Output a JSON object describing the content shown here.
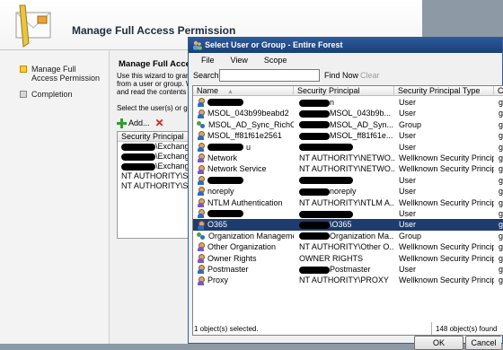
{
  "wizard": {
    "title": "Manage Full Access Permission",
    "nav": [
      {
        "label": "Manage Full Access Permission",
        "active": true
      },
      {
        "label": "Completion",
        "active": false
      }
    ],
    "content_title": "Manage Full Access",
    "desc_lines": [
      "Use this wizard to grant",
      "from a user or group. W",
      "and read the contents o"
    ],
    "select_text": "Select the user(s) or gro",
    "add_label": "Add...",
    "list_header": "Security Principal",
    "list_rows": [
      {
        "redacted": true,
        "text": "\\Exchange"
      },
      {
        "redacted": true,
        "text": "\\Exchange"
      },
      {
        "redacted": true,
        "text": "\\Exchange"
      },
      {
        "redacted": false,
        "text": "NT AUTHORITY\\SE"
      },
      {
        "redacted": false,
        "text": "NT AUTHORITY\\SY"
      }
    ]
  },
  "dialog": {
    "title": "Select User or Group - Entire Forest",
    "menu": [
      "File",
      "View",
      "Scope"
    ],
    "search_label": "Search:",
    "search_value": "",
    "find_now": "Find Now",
    "clear": "Clear",
    "columns": [
      "Name",
      "Security Principal",
      "Security Principal Type",
      "Co"
    ],
    "rows": [
      {
        "icon": "user",
        "name": "",
        "name_redacted": true,
        "principal": "n",
        "principal_redacted": true,
        "type": "User",
        "extra": "ge"
      },
      {
        "icon": "user",
        "name": "MSOL_043b99beabd2",
        "name_redacted": false,
        "principal": "MSOL_043b9b...",
        "principal_redacted": true,
        "type": "User",
        "extra": "ge"
      },
      {
        "icon": "group",
        "name": "MSOL_AD_Sync_RichC...",
        "name_redacted": false,
        "principal": "MSOL_AD_Syn...",
        "principal_redacted": true,
        "type": "Group",
        "extra": "ge"
      },
      {
        "icon": "user",
        "name": "MSOL_ff81f61e2561",
        "name_redacted": false,
        "principal": "MSOL_ff81f61e...",
        "principal_redacted": true,
        "type": "User",
        "extra": "ge"
      },
      {
        "icon": "user",
        "name": "u",
        "name_redacted": true,
        "principal": "",
        "principal_redacted": true,
        "type": "User",
        "extra": "ge"
      },
      {
        "icon": "wellknown",
        "name": "Network",
        "name_redacted": false,
        "principal": "NT AUTHORITY\\NETWO...",
        "principal_redacted": false,
        "type": "Wellknown Security Principal",
        "extra": "ge"
      },
      {
        "icon": "wellknown",
        "name": "Network Service",
        "name_redacted": false,
        "principal": "NT AUTHORITY\\NETWO...",
        "principal_redacted": false,
        "type": "Wellknown Security Principal",
        "extra": "ge"
      },
      {
        "icon": "user",
        "name": "",
        "name_redacted": true,
        "principal": "",
        "principal_redacted": true,
        "type": "User",
        "extra": "ge"
      },
      {
        "icon": "user",
        "name": "noreply",
        "name_redacted": false,
        "principal": "noreply",
        "principal_redacted": true,
        "type": "User",
        "extra": "ge"
      },
      {
        "icon": "wellknown",
        "name": "NTLM Authentication",
        "name_redacted": false,
        "principal": "NT AUTHORITY\\NTLM A...",
        "principal_redacted": false,
        "type": "Wellknown Security Principal",
        "extra": "ge"
      },
      {
        "icon": "user",
        "name": "",
        "name_redacted": true,
        "principal": "",
        "principal_redacted": true,
        "type": "User",
        "extra": "ge"
      },
      {
        "icon": "user",
        "name": "O365",
        "name_redacted": false,
        "principal": "\\O365",
        "principal_redacted": true,
        "type": "User",
        "extra": "ge",
        "selected": true
      },
      {
        "icon": "group",
        "name": "Organization Management",
        "name_redacted": false,
        "principal": "Organization Ma...",
        "principal_redacted": true,
        "type": "Group",
        "extra": "ge"
      },
      {
        "icon": "wellknown",
        "name": "Other Organization",
        "name_redacted": false,
        "principal": "NT AUTHORITY\\Other O...",
        "principal_redacted": false,
        "type": "Wellknown Security Principal",
        "extra": "ge"
      },
      {
        "icon": "wellknown",
        "name": "Owner Rights",
        "name_redacted": false,
        "principal": "OWNER RIGHTS",
        "principal_redacted": false,
        "type": "Wellknown Security Principal",
        "extra": "ge"
      },
      {
        "icon": "user",
        "name": "Postmaster",
        "name_redacted": false,
        "principal": "Postmaster",
        "principal_redacted": true,
        "type": "User",
        "extra": "ge"
      },
      {
        "icon": "wellknown",
        "name": "Proxy",
        "name_redacted": false,
        "principal": "NT AUTHORITY\\PROXY",
        "principal_redacted": false,
        "type": "Wellknown Security Principal",
        "extra": "ge"
      }
    ],
    "ok": "OK",
    "cancel": "Cancel",
    "status_left": "1 object(s) selected.",
    "status_right": "148 object(s) found"
  }
}
